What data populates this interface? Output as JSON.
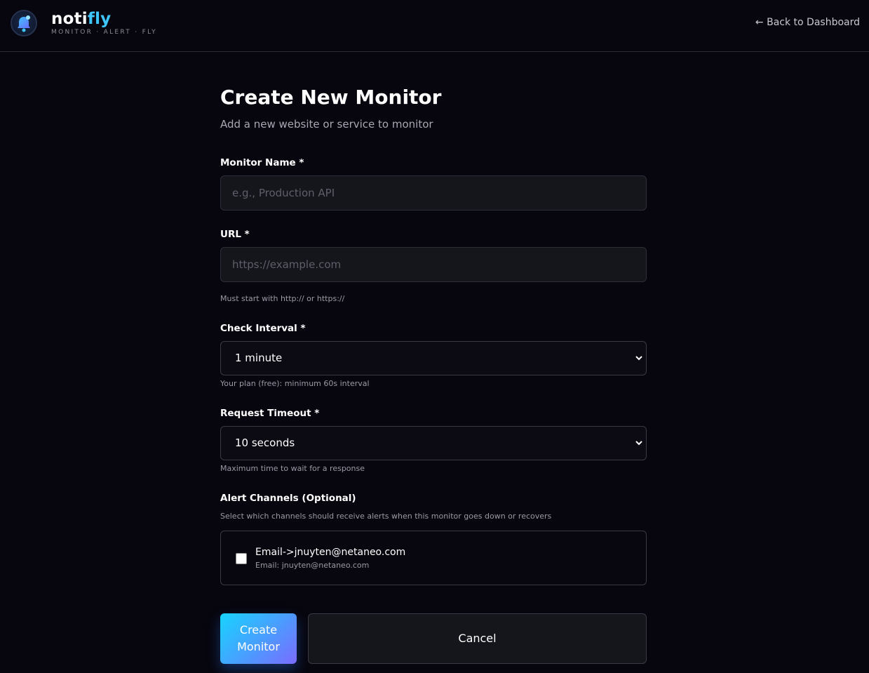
{
  "brand": {
    "name_part1": "noti",
    "name_part2": "fly",
    "tagline": "MONITOR · ALERT · FLY"
  },
  "header": {
    "back_link": "← Back to Dashboard"
  },
  "page": {
    "title": "Create New Monitor",
    "subtitle": "Add a new website or service to monitor"
  },
  "fields": {
    "monitor_name": {
      "label": "Monitor Name *",
      "placeholder": "e.g., Production API",
      "value": ""
    },
    "url": {
      "label": "URL *",
      "placeholder": "https://example.com",
      "value": "",
      "hint": "Must start with http:// or https://"
    },
    "check_interval": {
      "label": "Check Interval *",
      "selected": "1 minute",
      "hint": "Your plan (free): minimum 60s interval"
    },
    "request_timeout": {
      "label": "Request Timeout *",
      "selected": "10 seconds",
      "hint": "Maximum time to wait for a response"
    }
  },
  "alert_channels": {
    "label": "Alert Channels (Optional)",
    "hint": "Select which channels should receive alerts when this monitor goes down or recovers",
    "items": [
      {
        "title": "Email->jnuyten@netaneo.com",
        "subtitle": "Email: jnuyten@netaneo.com",
        "checked": false
      }
    ]
  },
  "actions": {
    "create_label": "Create Monitor",
    "cancel_label": "Cancel"
  },
  "colors": {
    "background": "#07060e",
    "accent_cyan": "#3ec6ff",
    "gradient_start": "#17d4ff",
    "gradient_end": "#7b6bff"
  },
  "icons": {
    "logo": "bell-icon",
    "select_arrow": "chevron-down-icon"
  }
}
